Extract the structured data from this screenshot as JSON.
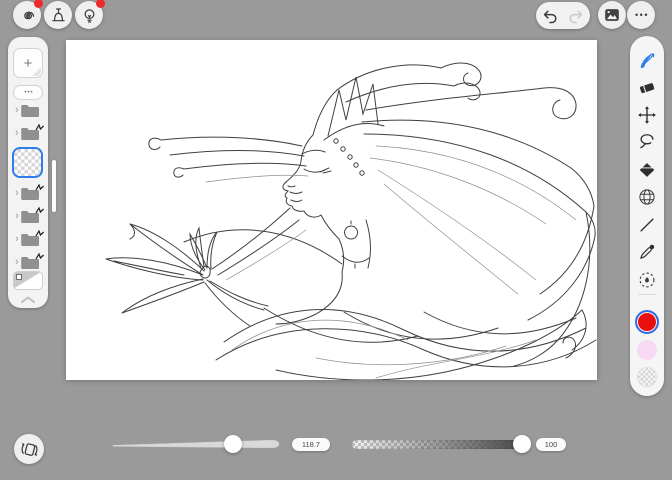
{
  "app": {
    "background": "#9a9a9a",
    "accent_blue": "#2f7ceb"
  },
  "glyphs": {
    "plus": "+",
    "ellipsis": "•••",
    "chevron_right": "›"
  },
  "top_left_toolbar": {
    "buttons": [
      {
        "id": "gallery",
        "icon": "spiral-icon",
        "notification_dot": true
      },
      {
        "id": "press-tool",
        "icon": "press-icon",
        "notification_dot": false
      },
      {
        "id": "tips",
        "icon": "lightbulb-icon",
        "notification_dot": true
      }
    ]
  },
  "top_right_toolbar": {
    "undo": {
      "icon": "undo-icon",
      "enabled": true
    },
    "redo": {
      "icon": "redo-icon",
      "enabled": false
    },
    "import_image": {
      "icon": "image-icon"
    },
    "more": {
      "icon": "ellipsis-icon"
    }
  },
  "layers_panel": {
    "add_layer": "+",
    "layer_options": "•••",
    "layers": [
      {
        "type": "folder",
        "collapsed": true,
        "badge": false
      },
      {
        "type": "folder",
        "collapsed": true,
        "badge": true
      },
      {
        "type": "layer",
        "selected": true,
        "content": "transparent"
      },
      {
        "type": "folder",
        "collapsed": true,
        "badge": true
      },
      {
        "type": "folder",
        "collapsed": true,
        "badge": true
      },
      {
        "type": "folder",
        "collapsed": true,
        "badge": true
      },
      {
        "type": "folder",
        "collapsed": true,
        "badge": true
      },
      {
        "type": "background-layer",
        "selected": false
      }
    ],
    "collapse_control": "chevron-up"
  },
  "tools_panel": {
    "tools": [
      {
        "id": "brush",
        "icon": "brush-icon",
        "selected": true,
        "color": "#2f7ceb"
      },
      {
        "id": "eraser",
        "icon": "eraser-icon",
        "selected": false
      },
      {
        "id": "move",
        "icon": "move-icon",
        "selected": false
      },
      {
        "id": "lasso",
        "icon": "lasso-icon",
        "selected": false
      },
      {
        "id": "fill",
        "icon": "diamond-fill-icon",
        "selected": false
      },
      {
        "id": "grid",
        "icon": "sphere-grid-icon",
        "selected": false
      },
      {
        "id": "line",
        "icon": "line-icon",
        "selected": false
      },
      {
        "id": "eyedropper",
        "icon": "eyedropper-icon",
        "selected": false
      },
      {
        "id": "special-brush",
        "icon": "dashed-circle-icon",
        "selected": false
      }
    ],
    "swatches": [
      {
        "id": "primary-color",
        "color": "#e90f0f",
        "selected": true
      },
      {
        "id": "secondary-color",
        "color": "#f7d9f3",
        "selected": false
      },
      {
        "id": "transparent-color",
        "pattern": "checkerboard",
        "selected": false
      }
    ]
  },
  "canvas": {
    "background": "#ffffff",
    "description": "black and white line-art of a woman in left profile wearing a crown, with wind-blown hair flowing right into braids and a ribbon bow on the left"
  },
  "bottom_bar": {
    "rotate_button": {
      "icon": "rotate-canvas-icon"
    },
    "size_slider": {
      "value": "118.7",
      "percent": 72
    },
    "opacity_slider": {
      "value": "100",
      "percent": 96
    }
  }
}
